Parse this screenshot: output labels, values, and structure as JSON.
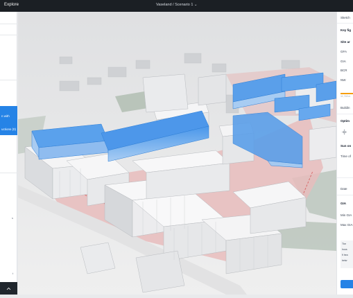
{
  "topbar": {
    "app_label": "Explore",
    "breadcrumb": "Vaseland / Scenario 1 ⌄"
  },
  "toolbar": {
    "icons": [
      "cursor-icon",
      "move-icon",
      "rotate-icon",
      "measure-icon"
    ]
  },
  "left_panel": {
    "highlight_line1": "n with",
    "highlight_line2": "uctions (0)",
    "snippet_a": "s",
    "snippet_b": "t"
  },
  "right_panel": {
    "sketch": "Sketch",
    "key_figures": "Key fig",
    "site_area": "Site ar",
    "gfa": "GFA",
    "gia": "GIA",
    "bcr": "BCR",
    "nw": "NW",
    "area_value": "11,718 m",
    "buildings": "Buildin",
    "options": "Optim",
    "sun_on": "Sun on",
    "time_of": "Time of",
    "date": "Date",
    "gia_section": "GIA",
    "min_gia": "Min GIA",
    "max_gia": "Max GIA",
    "note_line1": "The",
    "note_line2": "hous",
    "note_line3": "fi hea",
    "note_line4": "betw"
  },
  "colors": {
    "accent": "#2583e6",
    "topbar": "#1b1f24",
    "site_fill": "#e7b8b8",
    "building_blue": "#3d8fe4"
  }
}
